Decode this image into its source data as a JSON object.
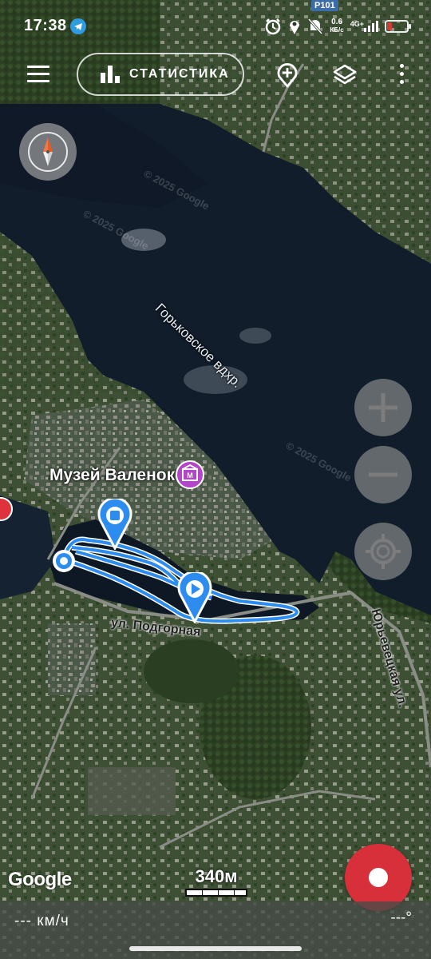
{
  "status_bar": {
    "time": "17:38",
    "speed_value": "0.6",
    "speed_unit": "КБ/с",
    "network": "4G+"
  },
  "toolbar": {
    "stats_label": "СТАТИСТИКА"
  },
  "map": {
    "labels": {
      "museum": "Музей Валенок",
      "reservoir": "Горьковское вдхр.",
      "street_podgornaya": "ул. Подгорная",
      "street_yurevetskaya": "Юрьевецкая ул.",
      "road_sign": "Р101"
    },
    "watermark": "© 2025 Google",
    "attribution": "Google",
    "scale_label": "340м",
    "track_color": "#2d8cf0"
  },
  "bottom_panel": {
    "speed": "--- км/ч",
    "heading": "---°"
  }
}
